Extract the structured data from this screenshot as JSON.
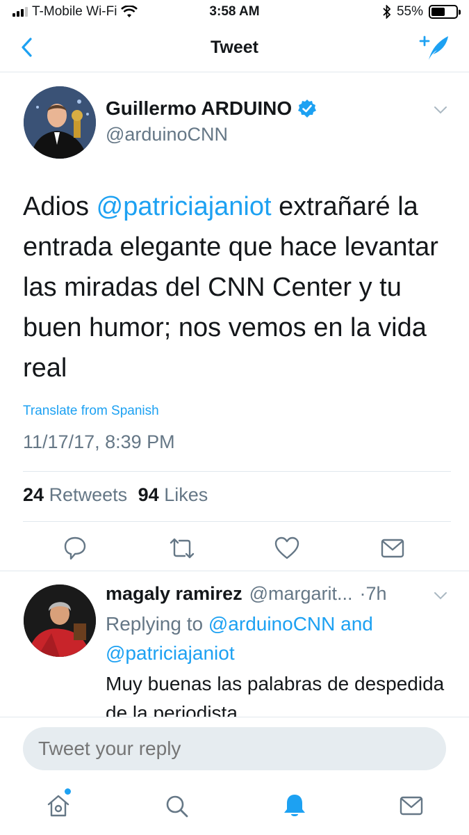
{
  "status_bar": {
    "carrier": "T-Mobile Wi-Fi",
    "time": "3:58 AM",
    "battery_percent": "55%",
    "battery_level": 0.55
  },
  "header": {
    "title": "Tweet",
    "back_icon": "chevron-left-icon",
    "compose_icon": "compose-tweet-icon"
  },
  "tweet": {
    "author_name": "Guillermo ARDUINO",
    "author_handle": "@arduinoCNN",
    "verified": true,
    "text_prefix": "Adios ",
    "mention": "@patriciajaniot",
    "text_suffix": " extrañaré la entrada elegante que hace levantar las miradas del CNN Center y tu buen humor; nos vemos en la vida real",
    "translate_label": "Translate from Spanish",
    "timestamp": "11/17/17, 8:39 PM",
    "retweet_count": "24",
    "retweet_label": "Retweets",
    "like_count": "94",
    "like_label": "Likes"
  },
  "reply": {
    "name": "magaly ramirez",
    "handle": "@margarit...",
    "time": "·7h",
    "replying_prefix": "Replying to ",
    "replying_to_1": "@arduinoCNN",
    "replying_and": " and",
    "replying_to_2": "@patriciajaniot",
    "text": "Muy buenas las palabras de despedida de la periodista"
  },
  "reply_bar": {
    "placeholder": "Tweet your reply"
  },
  "colors": {
    "accent": "#1da1f2",
    "muted": "#657786",
    "text": "#14171a"
  }
}
